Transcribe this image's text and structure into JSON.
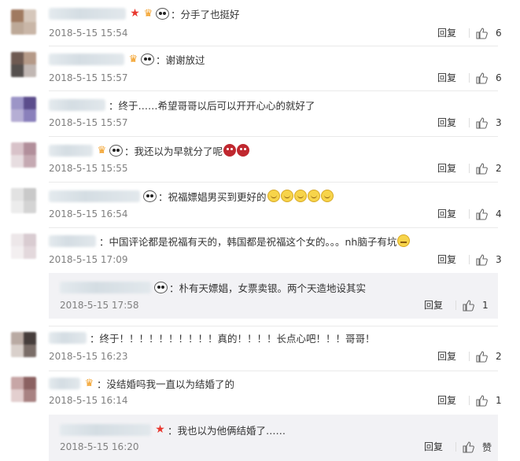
{
  "reply_label": "回复",
  "comments": [
    {
      "text": "：分手了也挺好",
      "time": "2018-5-15 15:54",
      "likes": "6",
      "avatar": [
        "#a07a60",
        "#d6c7bb",
        "#bda998",
        "#c9b6a7"
      ]
    },
    {
      "text": "：谢谢放过",
      "time": "2018-5-15 15:57",
      "likes": "6",
      "avatar": [
        "#6e5a52",
        "#b59a88",
        "#55504e",
        "#c1b7b3"
      ]
    },
    {
      "text": "：终于……希望哥哥以后可以开开心心的就好了",
      "time": "2018-5-15 15:57",
      "likes": "3",
      "avatar": [
        "#9c95c7",
        "#5b4d8c",
        "#b5aed4",
        "#8a80bb"
      ]
    },
    {
      "text": "：我还以为早就分了呢",
      "time": "2018-5-15 15:55",
      "likes": "2",
      "avatar": [
        "#d8c2c9",
        "#b28f9b",
        "#e7dde0",
        "#c5a9b2"
      ]
    },
    {
      "text": "：祝福嫖娼男买到更好的",
      "time": "2018-5-15 16:54",
      "likes": "4",
      "avatar": [
        "#e2e2e2",
        "#c9c9c9",
        "#ececec",
        "#d4d4d4"
      ]
    },
    {
      "text": "：中国评论都是祝福有天的，韩国都是祝福这个女的。。。nh脑子有坑",
      "time": "2018-5-15 17:09",
      "likes": "3",
      "avatar": [
        "#ede7e9",
        "#d9ccd1",
        "#f3eff0",
        "#e3d8dc"
      ]
    },
    {
      "text": "：朴有天嫖娼，女票卖银。两个天造地设其实",
      "time": "2018-5-15 17:58",
      "likes": "1"
    },
    {
      "text": "：终于！！！！！！！！！！真的！！！！长点心吧！！！哥哥！",
      "time": "2018-5-15 16:23",
      "likes": "2",
      "avatar": [
        "#b9aaa3",
        "#463d3b",
        "#d9d0cb",
        "#7a6d68"
      ]
    },
    {
      "text": "：没结婚吗我一直以为结婚了的",
      "time": "2018-5-15 16:14",
      "likes": "1",
      "avatar": [
        "#c7a6a6",
        "#8b6161",
        "#e3cfcf",
        "#a88282"
      ]
    },
    {
      "text": "：我也以为他俩结婚了……",
      "time": "2018-5-15 16:20",
      "likes": "赞"
    }
  ]
}
